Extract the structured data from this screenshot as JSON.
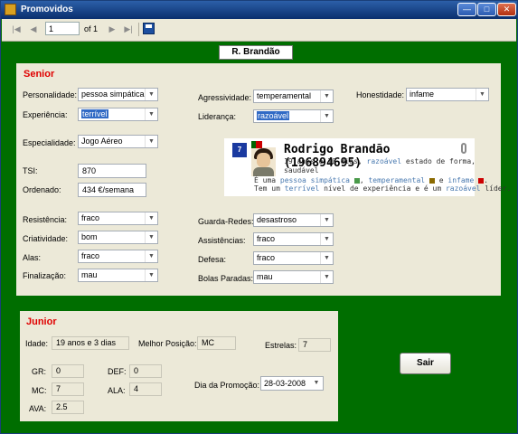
{
  "window": {
    "title": "Promovidos"
  },
  "toolbar": {
    "page": "1",
    "of_label": "of 1"
  },
  "player_name": "R. Brandão",
  "senior": {
    "title": "Senior",
    "personalidade": {
      "label": "Personalidade:",
      "value": "pessoa simpática"
    },
    "experiencia": {
      "label": "Experiência:",
      "value": "terrível"
    },
    "especialidade": {
      "label": "Especialidade:",
      "value": "Jogo Aéreo"
    },
    "tsi": {
      "label": "TSI:",
      "value": "870"
    },
    "ordenado": {
      "label": "Ordenado:",
      "value": "434 €/semana"
    },
    "agressividade": {
      "label": "Agressividade:",
      "value": "temperamental"
    },
    "lideranca": {
      "label": "Liderança:",
      "value": "razoável"
    },
    "honestidade": {
      "label": "Honestidade:",
      "value": "infame"
    },
    "resistencia": {
      "label": "Resistência:",
      "value": "fraco"
    },
    "criatividade": {
      "label": "Criatividade:",
      "value": "bom"
    },
    "alas": {
      "label": "Alas:",
      "value": "fraco"
    },
    "finalizacao": {
      "label": "Finalização:",
      "value": "mau"
    },
    "guarda_redes": {
      "label": "Guarda-Redes:",
      "value": "desastroso"
    },
    "assistencias": {
      "label": "Assistências:",
      "value": "fraco"
    },
    "defesa": {
      "label": "Defesa:",
      "value": "fraco"
    },
    "bolas_paradas": {
      "label": "Bolas  Paradas:",
      "value": "mau"
    }
  },
  "card": {
    "shirt_number": "7",
    "name": "Rodrigo Brandão (196894695)",
    "line1": "19 anos e 10 dias,",
    "line1_hl": "razoável",
    "line1_rest": "estado de forma,",
    "line2": "saudável",
    "line3_a": "É uma",
    "line3_hl1": "pessoa simpática",
    "line3_b": ",",
    "line3_hl2": "temperamental",
    "line3_c": "e",
    "line3_hl3": "infame",
    "line3_d": ".",
    "line4_a": "Tem um",
    "line4_hl1": "terrível",
    "line4_b": "nível de experiência e é um",
    "line4_hl2": "razoável",
    "line4_c": "líder.",
    "level_colors": {
      "temperamental": "#8b6a00",
      "infame": "#cc0000"
    }
  },
  "junior": {
    "title": "Junior",
    "idade": {
      "label": "Idade:",
      "value": "19 anos e 3 dias"
    },
    "melhor_posicao": {
      "label": "Melhor Posição:",
      "value": "MC"
    },
    "estrelas": {
      "label": "Estrelas:",
      "value": "7"
    },
    "gr": {
      "label": "GR:",
      "value": "0"
    },
    "def": {
      "label": "DEF:",
      "value": "0"
    },
    "mc": {
      "label": "MC:",
      "value": "7"
    },
    "ala": {
      "label": "ALA:",
      "value": "4"
    },
    "ava": {
      "label": "AVA:",
      "value": "2.5"
    },
    "dia_promocao": {
      "label": "Dia da Promoção:",
      "value": "28-03-2008"
    }
  },
  "buttons": {
    "sair": "Sair"
  },
  "colors": {
    "background": "#006e00",
    "panel": "#ece9d8",
    "title_red": "#e00000",
    "highlight": "#4a7ab0"
  }
}
